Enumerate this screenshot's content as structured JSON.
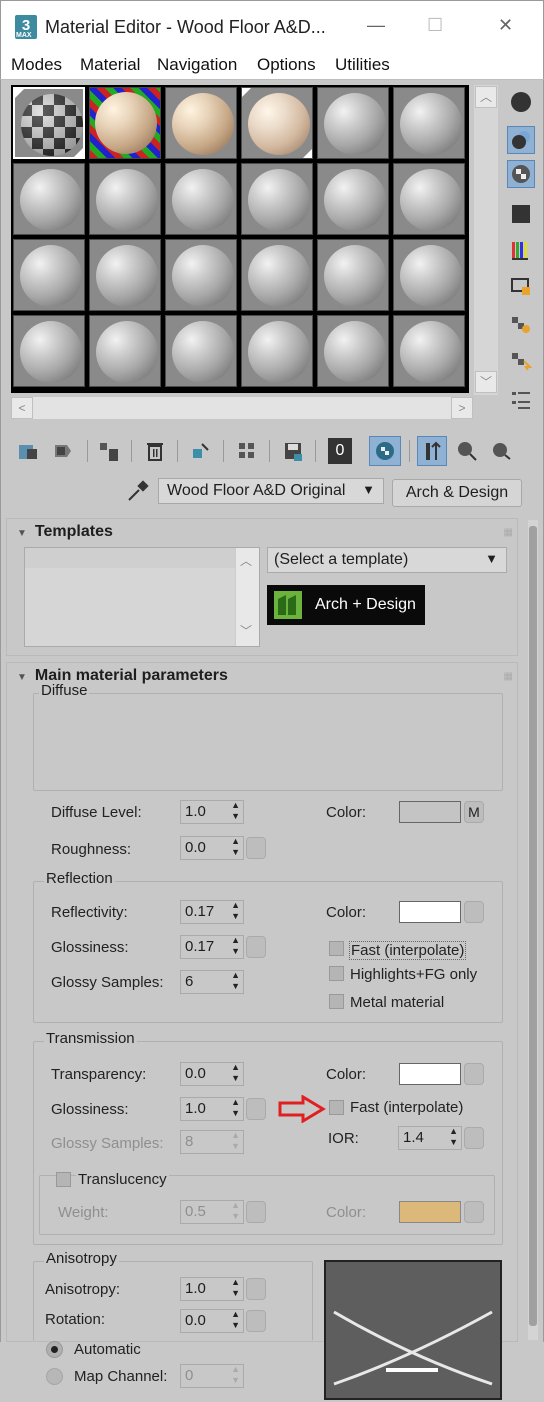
{
  "window": {
    "title": "Material Editor - Wood Floor A&D...",
    "minimize": "—",
    "maximize": "☐",
    "close": "✕",
    "app_badge": "3",
    "app_badge_sub": "MAX"
  },
  "menu": [
    "Modes",
    "Material",
    "Navigation",
    "Options",
    "Utilities"
  ],
  "toolbar": {
    "material_id": "0",
    "material_name": "Wood Floor A&D Original",
    "material_type": "Arch & Design"
  },
  "templates": {
    "title": "Templates",
    "select_placeholder": "(Select a template)",
    "logo_text": "Arch + Design"
  },
  "main_params": {
    "title": "Main material parameters",
    "diffuse": {
      "title": "Diffuse",
      "diffuse_level_label": "Diffuse Level:",
      "diffuse_level": "1.0",
      "roughness_label": "Roughness:",
      "roughness": "0.0",
      "color_label": "Color:",
      "color": "#c4c4c4",
      "map_button": "M"
    },
    "reflection": {
      "title": "Reflection",
      "reflectivity_label": "Reflectivity:",
      "reflectivity": "0.17",
      "glossiness_label": "Glossiness:",
      "glossiness": "0.17",
      "glossy_samples_label": "Glossy Samples:",
      "glossy_samples": "6",
      "color_label": "Color:",
      "color": "#ffffff",
      "fast_label": "Fast (interpolate)",
      "highlights_label": "Highlights+FG only",
      "metal_label": "Metal material"
    },
    "transmission": {
      "title": "Transmission",
      "transparency_label": "Transparency:",
      "transparency": "0.0",
      "glossiness_label": "Glossiness:",
      "glossiness": "1.0",
      "glossy_samples_label": "Glossy Samples:",
      "glossy_samples": "8",
      "color_label": "Color:",
      "color": "#ffffff",
      "fast_label": "Fast (interpolate)",
      "ior_label": "IOR:",
      "ior": "1.4",
      "translucency_label": "Translucency",
      "weight_label": "Weight:",
      "weight": "0.5",
      "translucency_color_label": "Color:",
      "translucency_color": "#dcb87a"
    },
    "anisotropy": {
      "title": "Anisotropy",
      "anisotropy_label": "Anisotropy:",
      "anisotropy": "1.0",
      "rotation_label": "Rotation:",
      "rotation": "0.0",
      "automatic_label": "Automatic",
      "map_channel_label": "Map Channel:",
      "map_channel": "0"
    }
  },
  "colors": {
    "highlight": "#8fb1d4",
    "annotation_arrow": "#e02020"
  }
}
